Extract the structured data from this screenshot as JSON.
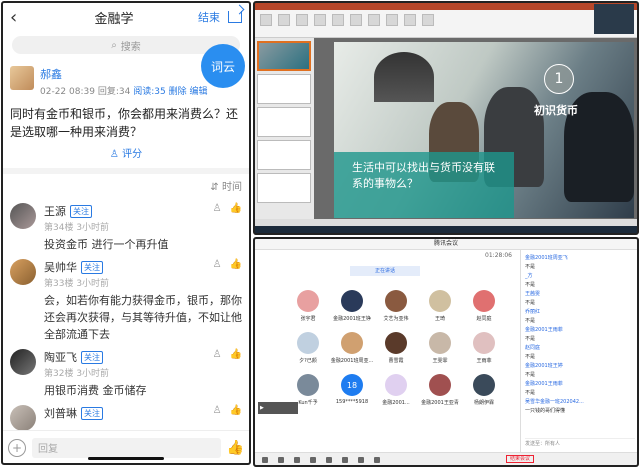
{
  "phone": {
    "nav": {
      "title": "金融学",
      "end_label": "结束"
    },
    "search_placeholder": "搜索",
    "word_cloud_label": "词云",
    "post": {
      "author": "郝鑫",
      "date": "02-22 08:39",
      "reply_label": "回复:34",
      "read_label": "阅读:35",
      "delete_label": "删除",
      "edit_label": "编辑",
      "text": "同时有金币和银币，你会都用来消费么？还是选取哪一种用来消费？",
      "rate_label": "评分"
    },
    "sort_label": "时间",
    "comments": [
      {
        "name": "王源",
        "tag": "关注",
        "floor": "第34楼",
        "time": "3小时前",
        "text": "投资金币 进行一个再升值"
      },
      {
        "name": "吴帅华",
        "tag": "关注",
        "floor": "第33楼",
        "time": "3小时前",
        "text": "会，如若你有能力获得金币，银币，那你还会再次获得，与其等待升值，不如让他全部流通下去"
      },
      {
        "name": "陶亚飞",
        "tag": "关注",
        "floor": "第32楼",
        "time": "3小时前",
        "text": "用银币消费 金币储存"
      },
      {
        "name": "刘普琳",
        "tag": "关注",
        "floor": "",
        "time": "",
        "text": ""
      }
    ],
    "reply_placeholder": "回复"
  },
  "ppt": {
    "slide_number": "1",
    "slide_title": "初识货币",
    "slide_question": "生活中可以找出与货币没有联系的事物么？"
  },
  "meeting": {
    "title": "腾讯会议",
    "timer": "01:28:06",
    "share_tag": "正在讲话",
    "participants": [
      {
        "name": "张宇君"
      },
      {
        "name": "金融2001班王铮"
      },
      {
        "name": "艾艺为亚伟"
      },
      {
        "name": "王琦"
      },
      {
        "name": "赵同庭"
      },
      {
        "name": "夕?已颜"
      },
      {
        "name": "金融2001班周亚..."
      },
      {
        "name": "曹雪霞"
      },
      {
        "name": "王雯霏"
      },
      {
        "name": "王雨菲"
      },
      {
        "name": "Kun千予"
      },
      {
        "name": "159****5918"
      },
      {
        "name": "金融2001..."
      },
      {
        "name": "金融2001王亚青"
      },
      {
        "name": "杨朗伊霖"
      }
    ],
    "badge_number": "18",
    "chat": [
      {
        "c": "b",
        "t": "金融2001班周亚飞"
      },
      {
        "c": "k",
        "t": "不是"
      },
      {
        "c": "b",
        "t": "_方"
      },
      {
        "c": "k",
        "t": "不是"
      },
      {
        "c": "b",
        "t": "王茜雯"
      },
      {
        "c": "k",
        "t": "不是"
      },
      {
        "c": "b",
        "t": "乔丽红"
      },
      {
        "c": "k",
        "t": "不是"
      },
      {
        "c": "b",
        "t": "金融2001王雨菲"
      },
      {
        "c": "k",
        "t": "不是"
      },
      {
        "c": "b",
        "t": "赵同庭"
      },
      {
        "c": "k",
        "t": "不是"
      },
      {
        "c": "b",
        "t": "金融2001班王婷"
      },
      {
        "c": "k",
        "t": "不是"
      },
      {
        "c": "b",
        "t": "金融2001王雨菲"
      },
      {
        "c": "k",
        "t": "不是"
      },
      {
        "c": "b",
        "t": "吴雪华金融一班202042..."
      },
      {
        "c": "k",
        "t": "一只钱的哥们得懂"
      }
    ],
    "chat_input": "发送至：所有人",
    "end_label": "结束会议"
  }
}
